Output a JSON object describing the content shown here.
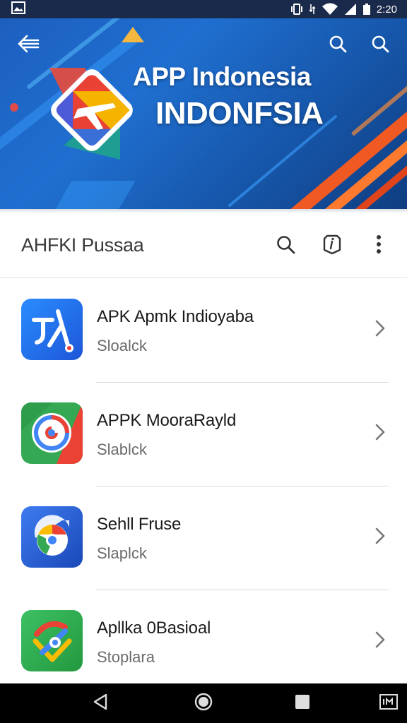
{
  "status_bar": {
    "time": "2:20",
    "icons": [
      "image-notification-icon",
      "vibrate-icon",
      "data-transfer-icon",
      "wifi-icon",
      "signal-icon",
      "battery-icon"
    ]
  },
  "hero": {
    "title_line1": "APP Indonesia",
    "title_line2": "INDONFSIA",
    "icons": [
      "back-arrow-icon",
      "search-icon",
      "search-icon"
    ]
  },
  "app_bar": {
    "title": "AHFKI Pussaa",
    "actions": [
      "search-icon",
      "info-tag-icon",
      "more-vert-icon"
    ]
  },
  "apps": [
    {
      "title": "APK Apmk Indioyaba",
      "subtitle": "Sloalck",
      "icon": "app-icon-blue-runner",
      "colors": [
        "#1e6ff0",
        "#3b8cff"
      ]
    },
    {
      "title": "APPK MooraRayld",
      "subtitle": "Slablck",
      "icon": "app-icon-google-swirl",
      "colors": [
        "#34a853",
        "#ea4335"
      ]
    },
    {
      "title": "Sehll Fruse",
      "subtitle": "Slaplck",
      "icon": "app-icon-chrome-pin",
      "colors": [
        "#1a56c8",
        "#3e7cf0"
      ]
    },
    {
      "title": "Apllka 0Basioal",
      "subtitle": "Stoplara",
      "icon": "app-icon-green-maps",
      "colors": [
        "#2fa84f",
        "#3cc063"
      ]
    }
  ],
  "nav_bar": {
    "buttons": [
      "back-triangle-icon",
      "home-circle-icon",
      "recents-square-icon",
      "screenshot-icon"
    ]
  },
  "colors": {
    "hero_blue": "#1d5fbf",
    "accent_orange": "#f05a22",
    "status_bar": "#1a2a4a",
    "nav_bar": "#000000"
  }
}
